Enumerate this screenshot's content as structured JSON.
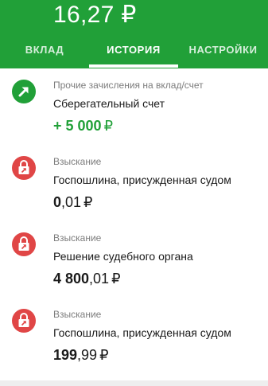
{
  "account": {
    "balance": "16,27 ₽"
  },
  "tabs": [
    {
      "label": "ВКЛАД"
    },
    {
      "label": "ИСТОРИЯ"
    },
    {
      "label": "НАСТРОЙКИ"
    }
  ],
  "active_tab": "ИСТОРИЯ",
  "colors": {
    "brand": "#21a038",
    "lock_red": "#e04646",
    "text_secondary": "#7c7c7c"
  },
  "transactions": [
    {
      "icon": "arrow-up-right-icon",
      "category": "Прочие зачисления на вклад/счет",
      "description": "Сберегательный счет",
      "amount_sign": "+ ",
      "amount_int": "5 000",
      "amount_frac": "",
      "currency": "₽",
      "type": "income"
    },
    {
      "icon": "lock-arrow-icon",
      "category": "Взыскание",
      "description": "Госпошлина, присужденная судом",
      "amount_sign": "",
      "amount_int": "0",
      "amount_frac": ",01",
      "currency": "₽",
      "type": "expense"
    },
    {
      "icon": "lock-arrow-icon",
      "category": "Взыскание",
      "description": "Решение судебного органа",
      "amount_sign": "",
      "amount_int": "4 800",
      "amount_frac": ",01",
      "currency": "₽",
      "type": "expense"
    },
    {
      "icon": "lock-arrow-icon",
      "category": "Взыскание",
      "description": "Госпошлина, присужденная судом",
      "amount_sign": "",
      "amount_int": "199",
      "amount_frac": ",99",
      "currency": "₽",
      "type": "expense"
    }
  ]
}
